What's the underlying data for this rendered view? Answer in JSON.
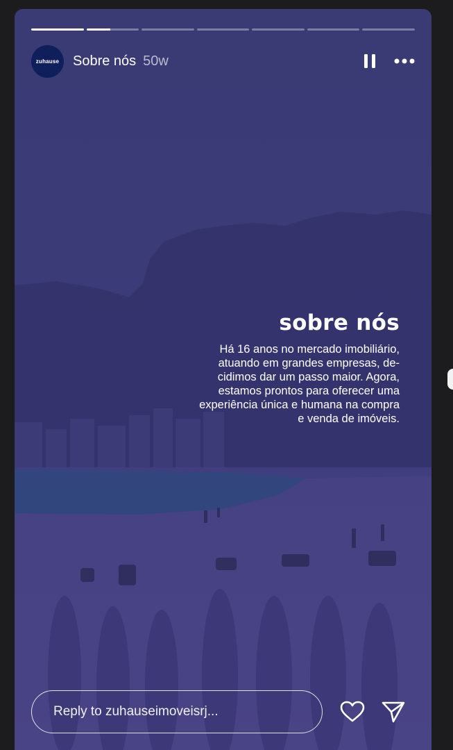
{
  "story": {
    "title": "Sobre nós",
    "age": "50w",
    "avatar_text": "zuhause",
    "progress_segments": [
      1,
      0.45,
      0,
      0,
      0,
      0,
      0
    ]
  },
  "content": {
    "headline": "sobre nós",
    "body": "Há 16 anos no mercado imobiliário, atuando em grandes empresas, de-cidimos dar um passo maior. Agora, estamos prontos para oferecer uma experiência única e humana na compra e venda de imóveis."
  },
  "footer": {
    "reply_placeholder": "Reply to zuhauseimoveisrj..."
  },
  "icons": [
    "pause-icon",
    "more-icon",
    "heart-icon",
    "send-icon"
  ],
  "colors": {
    "overlay": "#3c3b7a",
    "avatar": "#0f1f5c",
    "text": "#ffffff"
  }
}
